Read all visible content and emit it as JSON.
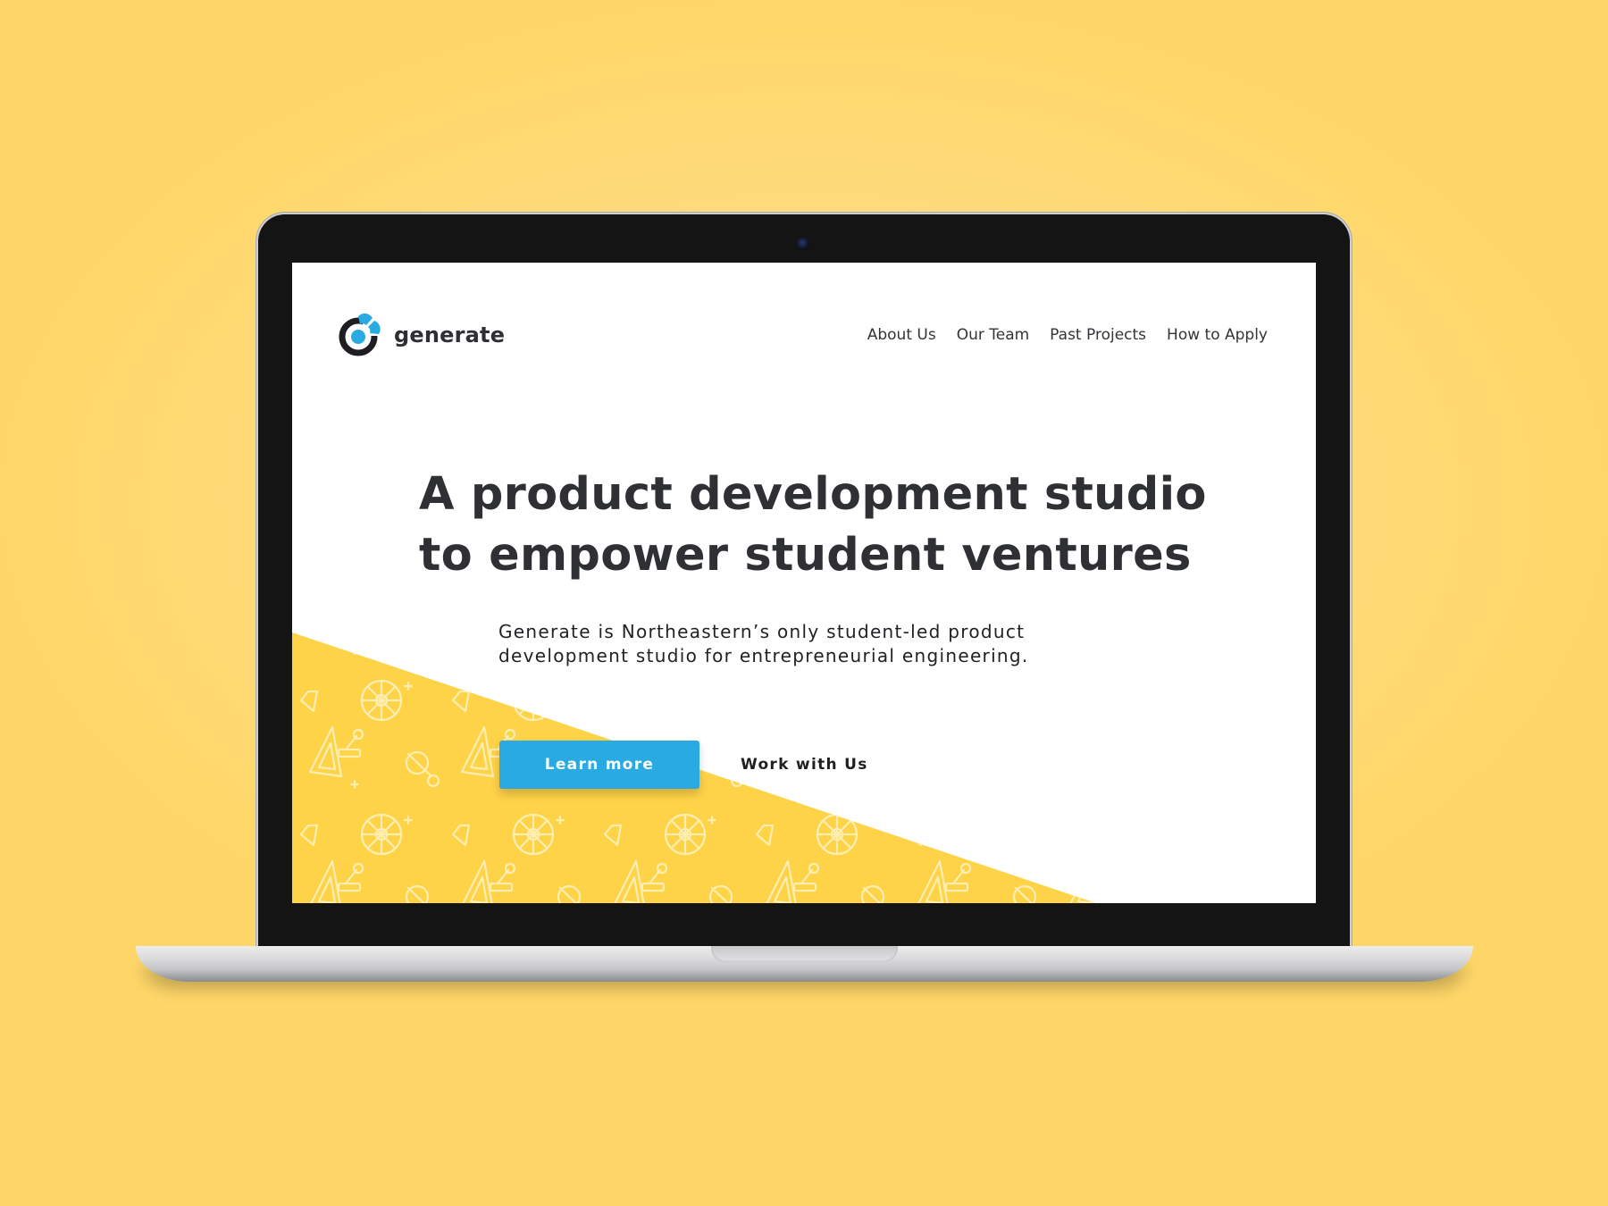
{
  "brand": {
    "name": "generate",
    "colors": {
      "primary_blue": "#29aae2",
      "dark": "#2f3034",
      "accent_yellow": "#ffd347",
      "background_yellow": "#ffd769"
    }
  },
  "nav": {
    "items": [
      {
        "label": "About Us"
      },
      {
        "label": "Our Team"
      },
      {
        "label": "Past Projects"
      },
      {
        "label": "How to Apply"
      }
    ]
  },
  "hero": {
    "headline_lines": [
      "A product development studio",
      "to empower student ventures"
    ],
    "subtext_lines": [
      "Generate is Northeastern’s only student-led product",
      "development studio for entrepreneurial engineering."
    ],
    "primary_button": "Learn more",
    "secondary_button": "Work with Us",
    "pattern_icons": [
      "gear-icon",
      "wrench-icon",
      "joystick-icon",
      "screw-icon",
      "set-square-icon",
      "belt-pulley-icon",
      "plus-sign-icon"
    ]
  }
}
